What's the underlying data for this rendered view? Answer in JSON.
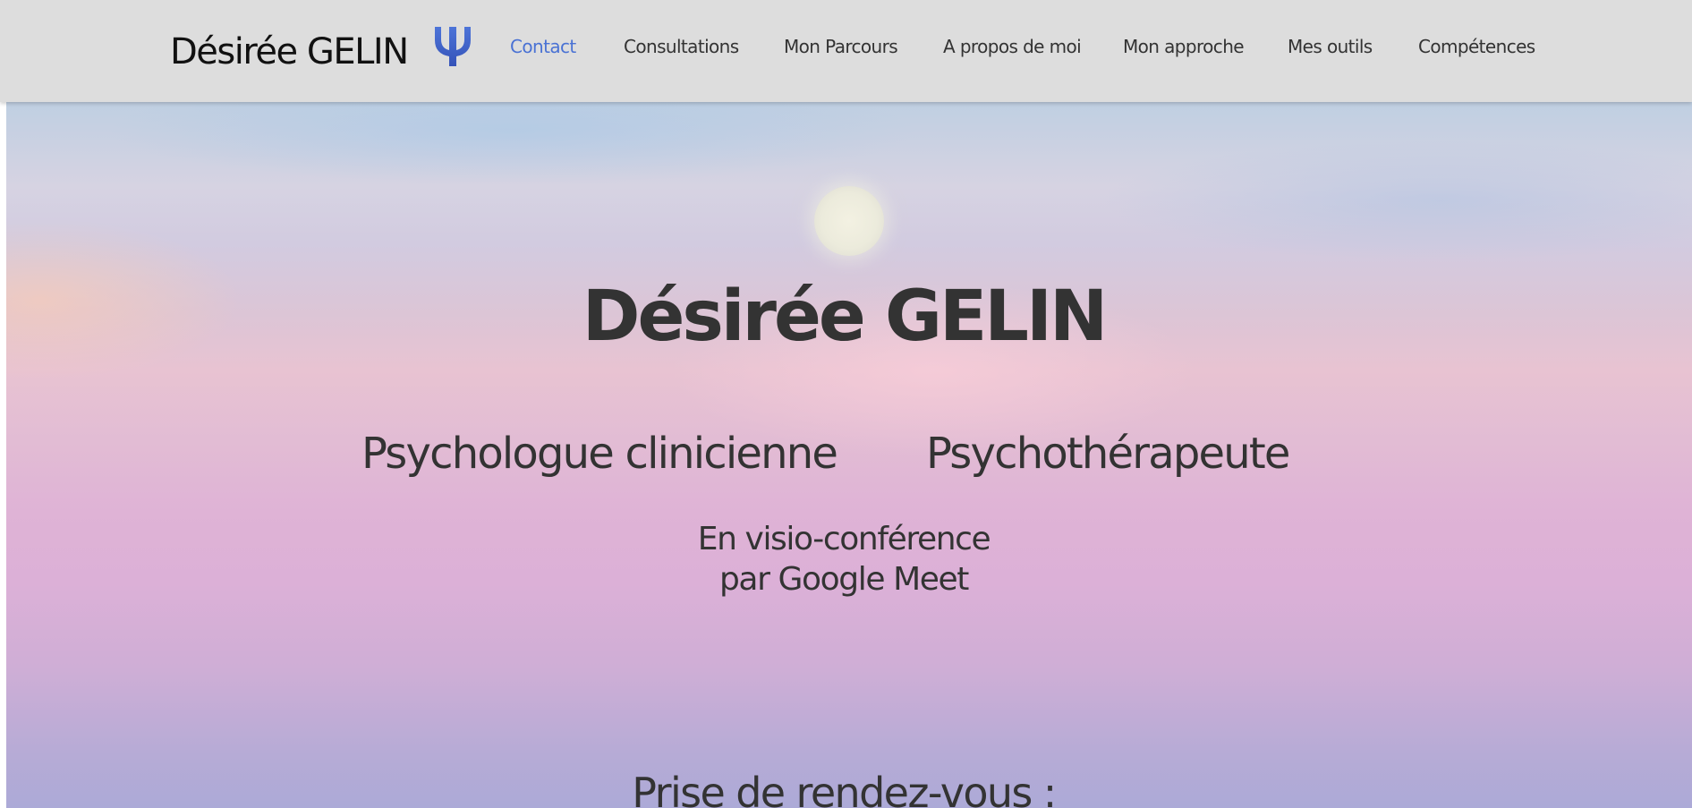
{
  "header": {
    "brand": "Désirée GELIN",
    "logo_icon": "psi-icon",
    "nav": [
      {
        "label": "Contact",
        "active": true
      },
      {
        "label": "Consultations",
        "active": false
      },
      {
        "label": "Mon Parcours",
        "active": false
      },
      {
        "label": "A propos de moi",
        "active": false
      },
      {
        "label": "Mon approche",
        "active": false
      },
      {
        "label": "Mes outils",
        "active": false
      },
      {
        "label": "Compétences",
        "active": false
      }
    ]
  },
  "hero": {
    "title": "Désirée GELIN",
    "subtitle_left": "Psychologue clinicienne",
    "subtitle_right": "Psychothérapeute",
    "visio_line1": "En visio-conférence",
    "visio_line2": "par Google Meet",
    "appointment_heading": "Prise de rendez-vous :"
  },
  "colors": {
    "header_bg": "#dddddd",
    "nav_active": "#4a72d4",
    "nav_text": "#333333",
    "logo_blue": "#3d5fc8",
    "hero_text": "#333333"
  }
}
